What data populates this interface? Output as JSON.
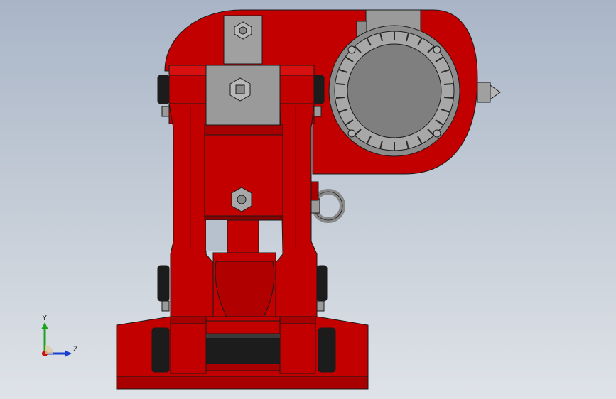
{
  "viewport": {
    "background_top": "#a9b5c7",
    "background_bottom": "#dfe3e8"
  },
  "model": {
    "body_color": "#c20000",
    "body_dark": "#8a0000",
    "body_shadow": "#6e0000",
    "steel_color": "#9a9a9a",
    "motor_color": "#8c8c8c",
    "rubber_color": "#1c1c1c",
    "edge_color": "#1a1a1a"
  },
  "triad": {
    "y_label": "Y",
    "z_label": "Z",
    "y_color": "#1fa31f",
    "z_color": "#1a3fd0",
    "x_color": "#c81010"
  }
}
